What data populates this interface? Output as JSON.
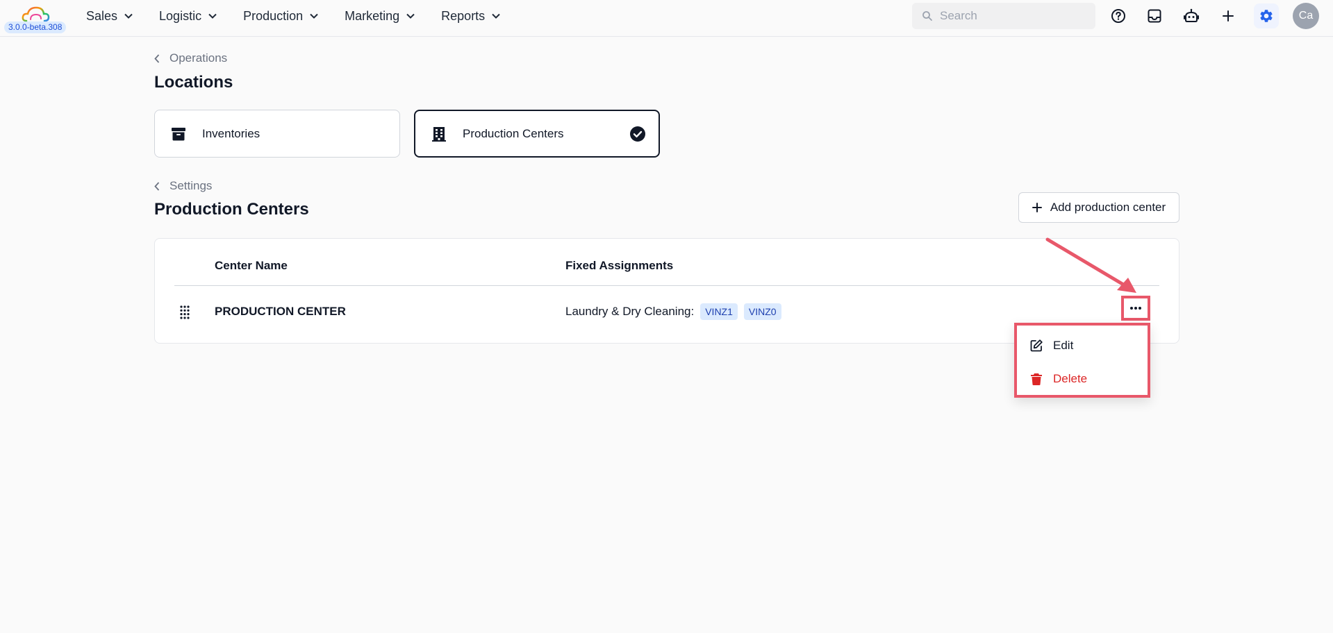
{
  "app": {
    "version": "3.0.0-beta.308"
  },
  "nav": {
    "items": [
      {
        "label": "Sales"
      },
      {
        "label": "Logistic"
      },
      {
        "label": "Production"
      },
      {
        "label": "Marketing"
      },
      {
        "label": "Reports"
      }
    ]
  },
  "search": {
    "placeholder": "Search",
    "value": ""
  },
  "toolbar": {
    "icons": [
      "help-icon",
      "inbox-icon",
      "assistant-robot-icon",
      "plus-icon",
      "settings-gear-icon"
    ],
    "accent_color": "#2563eb"
  },
  "user": {
    "initials": "Ca"
  },
  "locations": {
    "breadcrumb": "Operations",
    "title": "Locations",
    "cards": [
      {
        "label": "Inventories",
        "icon": "archive-box-icon",
        "selected": false
      },
      {
        "label": "Production Centers",
        "icon": "building-icon",
        "selected": true
      }
    ]
  },
  "production_centers": {
    "breadcrumb": "Settings",
    "title": "Production Centers",
    "add_button_label": "Add production center",
    "columns": [
      "Center Name",
      "Fixed Assignments"
    ],
    "rows": [
      {
        "name": "PRODUCTION CENTER",
        "assignment_label": "Laundry & Dry Cleaning:",
        "tags": [
          "VINZ1",
          "VINZ0"
        ]
      }
    ]
  },
  "row_menu": {
    "edit_label": "Edit",
    "delete_label": "Delete",
    "highlight_color": "#e8586a",
    "delete_color": "#dc2626"
  }
}
